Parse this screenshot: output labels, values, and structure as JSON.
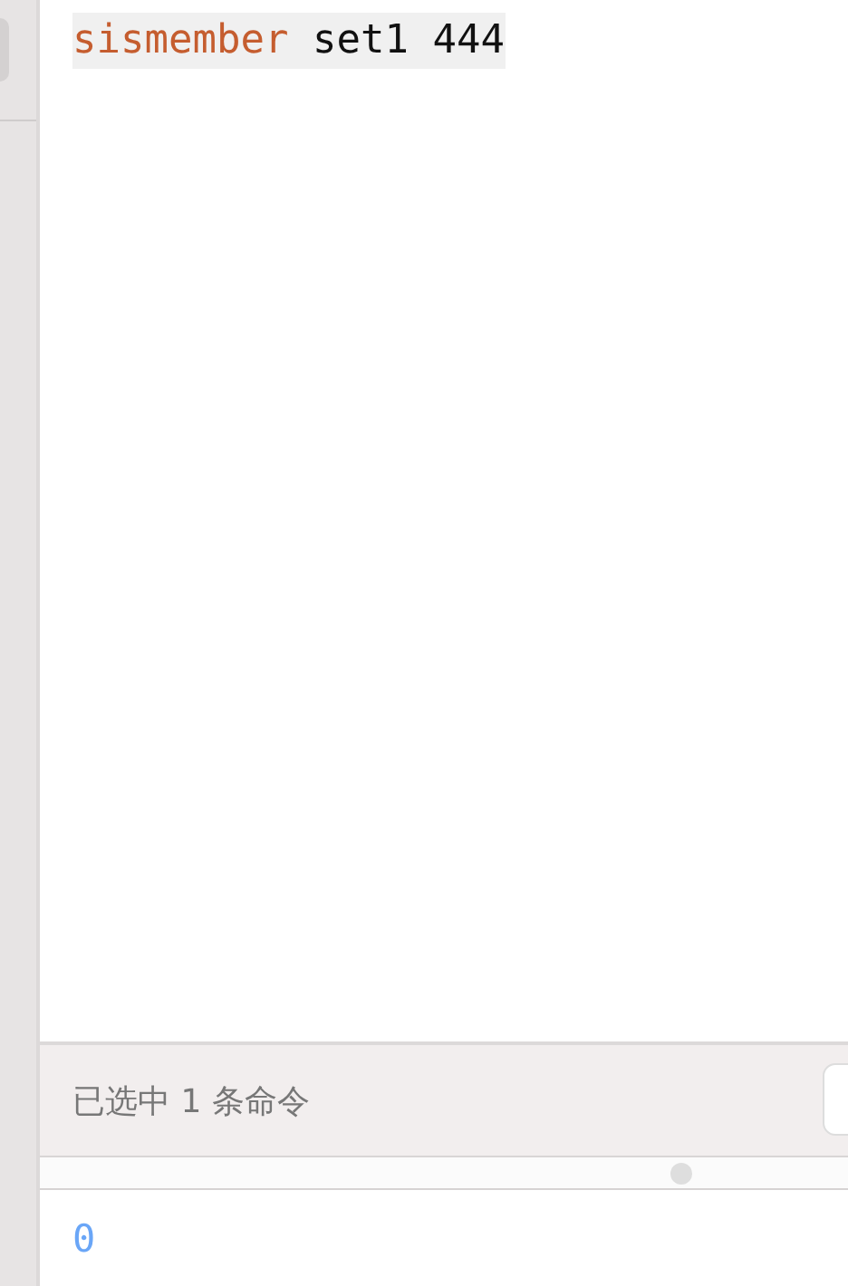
{
  "editor": {
    "tokens": [
      {
        "kind": "command",
        "text": "sismember"
      },
      {
        "kind": "arg",
        "text": "set1"
      },
      {
        "kind": "arg",
        "text": "444"
      }
    ]
  },
  "selection_bar": {
    "text": "已选中 1 条命令"
  },
  "result": {
    "text": "0"
  }
}
